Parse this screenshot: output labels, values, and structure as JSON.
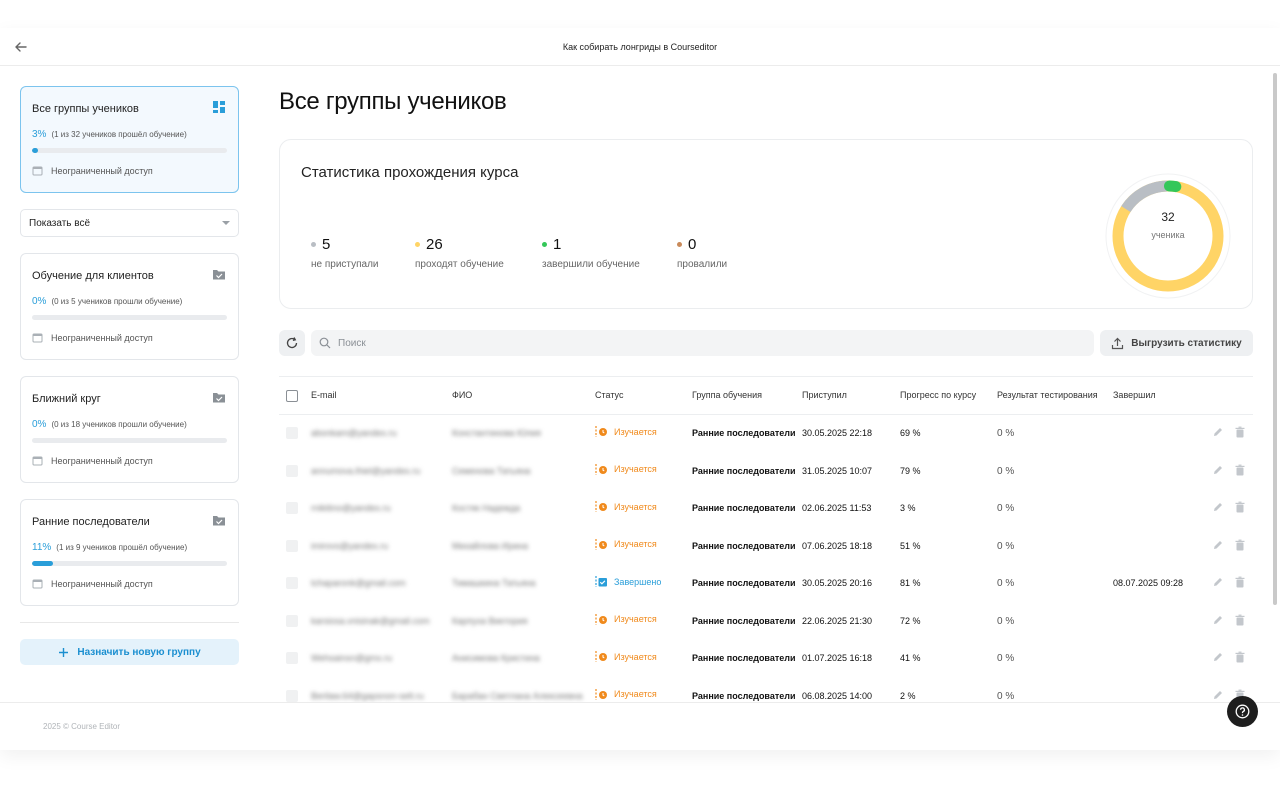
{
  "header": {
    "title": "Как собирать лонгриды в Courseditor"
  },
  "sidebar": {
    "all_groups": {
      "title": "Все группы учеников",
      "percent": "3%",
      "progress": 0.03,
      "note": "(1 из 32 учеников прошёл обучение)",
      "access": "Неограниченный доступ"
    },
    "filter": {
      "selected": "Показать всё"
    },
    "groups": [
      {
        "title": "Обучение для клиентов",
        "percent": "0%",
        "progress": 0.0,
        "note": "(0 из 5 учеников прошли обучение)",
        "access": "Неограниченный доступ"
      },
      {
        "title": "Ближний круг",
        "percent": "0%",
        "progress": 0.0,
        "note": "(0 из 18 учеников прошли обучение)",
        "access": "Неограниченный доступ"
      },
      {
        "title": "Ранние последователи",
        "percent": "11%",
        "progress": 0.11,
        "note": "(1 из 9 учеников прошёл обучение)",
        "access": "Неограниченный доступ"
      }
    ],
    "assign_button": "Назначить новую группу"
  },
  "main": {
    "title": "Все группы учеников",
    "stats": {
      "title": "Статистика прохождения курса",
      "items": [
        {
          "value": "5",
          "label": "не приступали",
          "color": "#b9bec4"
        },
        {
          "value": "26",
          "label": "проходят обучение",
          "color": "#ffd466"
        },
        {
          "value": "1",
          "label": "завершили обучение",
          "color": "#34c759"
        },
        {
          "value": "0",
          "label": "провалили",
          "color": "#c98a5a"
        }
      ],
      "total": "32",
      "total_label": "ученика"
    },
    "toolbar": {
      "search_placeholder": "Поиск",
      "export_label": "Выгрузить статистику"
    },
    "table": {
      "columns": {
        "email": "E-mail",
        "name": "ФИО",
        "status": "Статус",
        "group": "Группа обучения",
        "started": "Приступил",
        "progress": "Прогресс по курсу",
        "result": "Результат тестирования",
        "finished": "Завершил"
      },
      "rows": [
        {
          "email": "abonkam@yandex.ru",
          "name": "Константинова Юлия",
          "status": "Изучается",
          "state": "learning",
          "group": "Ранние последователи",
          "started": "30.05.2025 22:18",
          "progress": "69 %",
          "result": "0 %",
          "finished": ""
        },
        {
          "email": "annumova.lhiel@yandex.ru",
          "name": "Семенова Татьяна",
          "status": "Изучается",
          "state": "learning",
          "group": "Ранние последователи",
          "started": "31.05.2025 10:07",
          "progress": "79 %",
          "result": "0 %",
          "finished": ""
        },
        {
          "email": "rnikitino@yandex.ru",
          "name": "Костяк Надежда",
          "status": "Изучается",
          "state": "learning",
          "group": "Ранние последователи",
          "started": "02.06.2025 11:53",
          "progress": "3 %",
          "result": "0 %",
          "finished": ""
        },
        {
          "email": "imirovs@yandex.ru",
          "name": "Михайлова Ирина",
          "status": "Изучается",
          "state": "learning",
          "group": "Ранние последователи",
          "started": "07.06.2025 18:18",
          "progress": "51 %",
          "result": "0 %",
          "finished": ""
        },
        {
          "email": "tchaparonk@gmail.com",
          "name": "Тимашкина Татьяна",
          "status": "Завершено",
          "state": "done",
          "group": "Ранние последователи",
          "started": "30.05.2025 20:16",
          "progress": "81 %",
          "result": "0 %",
          "finished": "08.07.2025 09:28"
        },
        {
          "email": "karsiosa.vnisinak@gmail.com",
          "name": "Карпуха Виктория",
          "status": "Изучается",
          "state": "learning",
          "group": "Ранние последователи",
          "started": "22.06.2025 21:30",
          "progress": "72 %",
          "result": "0 %",
          "finished": ""
        },
        {
          "email": "Wehsainsn@gmx.ru",
          "name": "Анисимова Кристина",
          "status": "Изучается",
          "state": "learning",
          "group": "Ранние последователи",
          "started": "01.07.2025 16:18",
          "progress": "41 %",
          "result": "0 %",
          "finished": ""
        },
        {
          "email": "Berilaw.64@gapsnon-selt.ru",
          "name": "Барабан Светлана Алексеевна",
          "status": "Изучается",
          "state": "learning",
          "group": "Ранние последователи",
          "started": "06.08.2025 14:00",
          "progress": "2 %",
          "result": "0 %",
          "finished": ""
        }
      ]
    }
  },
  "footer": {
    "copyright": "2025 © Course Editor"
  },
  "colors": {
    "accent": "#2a9ed9",
    "learning": "#f08a1c",
    "donut_learning": "#ffd466",
    "donut_not_started": "#b9bec4",
    "donut_done": "#34c759"
  }
}
